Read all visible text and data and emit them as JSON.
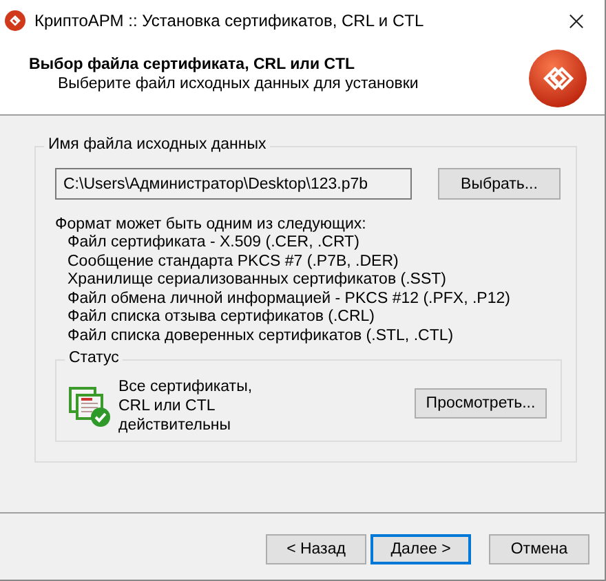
{
  "window": {
    "title": "КриптоАРМ :: Установка сертификатов, CRL и CTL"
  },
  "header": {
    "title": "Выбор файла сертификата, CRL или CTL",
    "subtitle": "Выберите файл исходных данных для установки"
  },
  "file_group": {
    "legend": "Имя файла исходных данных",
    "path": "C:\\Users\\Администратор\\Desktop\\123.p7b",
    "browse_button": "Выбрать...",
    "formats_intro": "Формат может быть одним из следующих:",
    "formats": [
      "Файл сертификата - X.509 (.CER, .CRT)",
      "Сообщение стандарта PKCS #7 (.P7B, .DER)",
      "Хранилище сериализованных сертификатов (.SST)",
      "Файл обмена личной информацией - PKCS #12 (.PFX, .P12)",
      "Файл списка отзыва сертификатов (.CRL)",
      "Файл списка доверенных сертификатов (.STL, .CTL)"
    ]
  },
  "status_group": {
    "legend": "Статус",
    "message": "Все сертификаты, CRL или CTL действительны",
    "view_button": "Просмотреть..."
  },
  "buttons": [
    {
      "label": "< Назад",
      "default": false
    },
    {
      "label": "Далее >",
      "default": true
    },
    {
      "label": "Отмена",
      "default": false
    }
  ]
}
